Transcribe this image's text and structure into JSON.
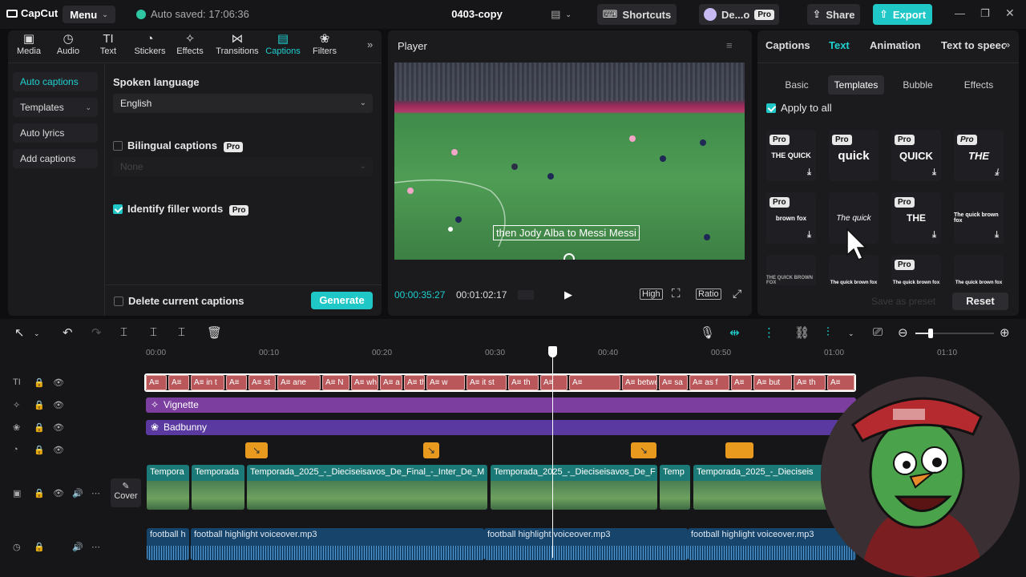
{
  "topbar": {
    "logo": "CapCut",
    "menu": "Menu",
    "autosave": "Auto saved: 17:06:36",
    "title": "0403-copy",
    "shortcuts": "Shortcuts",
    "user": "De...o",
    "pro": "Pro",
    "share": "Share",
    "export": "Export"
  },
  "tools": [
    {
      "label": "Media",
      "icon": "▣"
    },
    {
      "label": "Audio",
      "icon": "◷"
    },
    {
      "label": "Text",
      "icon": "TI"
    },
    {
      "label": "Stickers",
      "icon": "◔"
    },
    {
      "label": "Effects",
      "icon": "✧"
    },
    {
      "label": "Transitions",
      "icon": "⋈"
    },
    {
      "label": "Captions",
      "icon": "▤"
    },
    {
      "label": "Filters",
      "icon": "❀"
    }
  ],
  "left_sidebar": {
    "items": [
      "Auto captions",
      "Templates",
      "Auto lyrics",
      "Add captions"
    ]
  },
  "captions_panel": {
    "spoken_language_label": "Spoken language",
    "language": "English",
    "bilingual": "Bilingual captions",
    "bilingual_none": "None",
    "filler": "Identify filler words",
    "delete_current": "Delete current captions",
    "generate": "Generate"
  },
  "player": {
    "label": "Player",
    "caption_text": "then Jody Alba to Messi Messi",
    "current_time": "00:00:35:27",
    "total_time": "00:01:02:17",
    "quality": "High",
    "ratio": "Ratio"
  },
  "right_panel": {
    "tabs": [
      "Captions",
      "Text",
      "Animation",
      "Text to speech"
    ],
    "sub_tabs": [
      "Basic",
      "Templates",
      "Bubble",
      "Effects"
    ],
    "apply_all": "Apply to all",
    "templates": [
      {
        "text": "THE QUICK",
        "pro": true
      },
      {
        "text": "quick",
        "pro": true
      },
      {
        "text": "QUICK",
        "pro": true
      },
      {
        "text": "THE",
        "pro": true
      },
      {
        "text": "brown fox",
        "pro": true
      },
      {
        "text": "The quick",
        "pro": false
      },
      {
        "text": "THE",
        "pro": true
      },
      {
        "text": "The quick brown fox",
        "pro": false
      },
      {
        "text": "THE QUICK BROWN FOX",
        "pro": false
      },
      {
        "text": "The quick brown fox",
        "pro": false
      },
      {
        "text": "The quick brown fox",
        "pro": true
      },
      {
        "text": "The quick brown fox",
        "pro": false
      }
    ],
    "save_preset": "Save as preset",
    "reset": "Reset"
  },
  "timeline": {
    "ruler": [
      "00:00",
      "00:10",
      "00:20",
      "00:30",
      "00:40",
      "00:50",
      "01:00",
      "01:10"
    ],
    "caption_clips": [
      "A≡",
      "A≡",
      "A≡ in t",
      "A≡",
      "A≡ st",
      "A≡ ane",
      "A≡ N",
      "A≡ wh",
      "A≡ a",
      "A≡ th",
      "A≡ w",
      "A≡ it st",
      "A≡ th",
      "A≡",
      "A≡",
      "A≡ betwe",
      "A≡ sa",
      "A≡ as f",
      "A≡",
      "A≡ but",
      "A≡ th",
      "A≡"
    ],
    "vignette": "Vignette",
    "badbunny": "Badbunny",
    "video_clips": [
      "Tempora",
      "Temporada",
      "Temporada_2025_-_Dieciseisavos_De_Final_-_Inter_De_M",
      "Temporada_2025_-_Dieciseisavos_De_F",
      "Temp",
      "Temporada_2025_-_Dieciseis"
    ],
    "cover": "Cover",
    "audio_clips": [
      "football h",
      "football highlight voiceover.mp3",
      "football highlight voiceover.mp3",
      "football highlight voiceover.mp3"
    ]
  }
}
